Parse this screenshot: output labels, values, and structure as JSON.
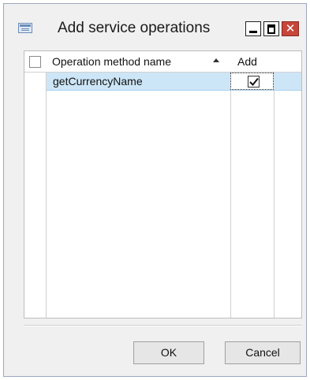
{
  "window": {
    "title": "Add service operations",
    "controls": {
      "close_glyph": "✕"
    },
    "icons": [
      "app-icon",
      "minimize-icon",
      "maximize-icon",
      "close-icon"
    ]
  },
  "grid": {
    "columns": [
      {
        "label": "Operation method name",
        "sort": "ascending"
      },
      {
        "label": "Add"
      }
    ],
    "rows": [
      {
        "name": "getCurrencyName",
        "add": true,
        "selected": true
      }
    ],
    "row_highlight_color": "#cde6f7"
  },
  "buttons": {
    "ok": "OK",
    "cancel": "Cancel"
  }
}
